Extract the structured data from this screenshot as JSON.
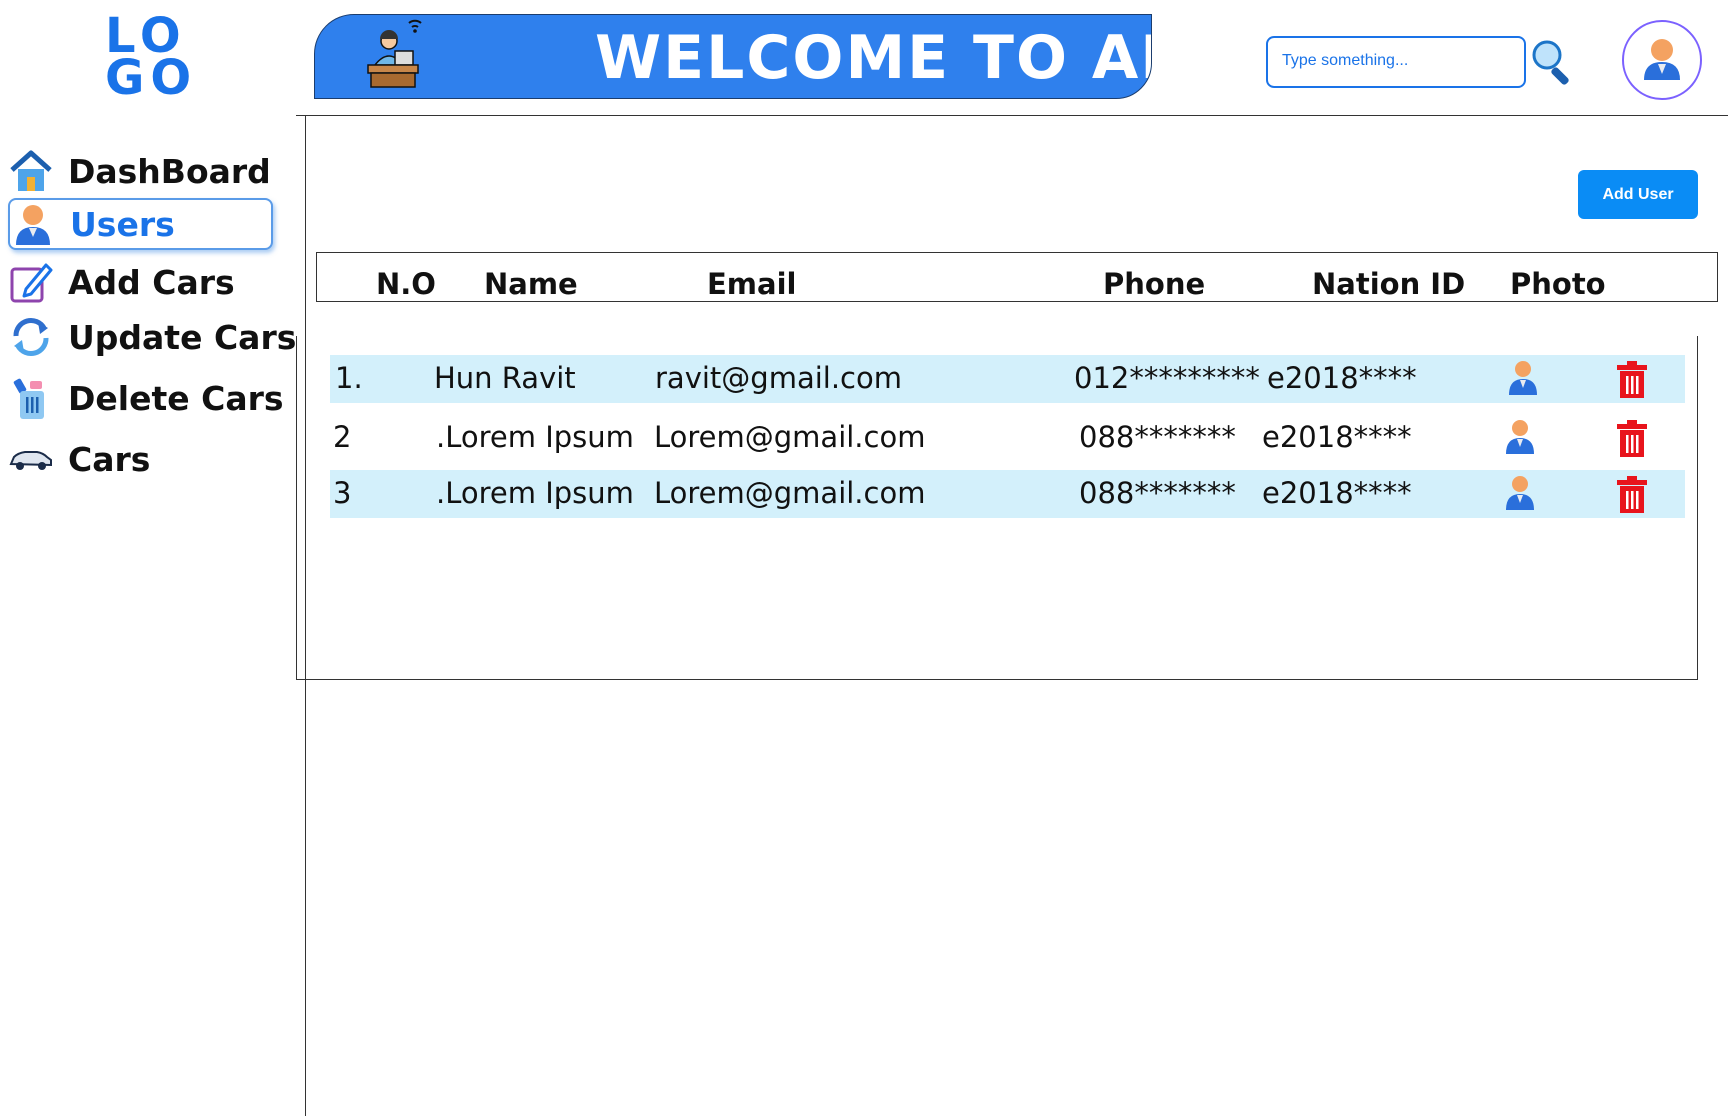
{
  "logo": {
    "line1": "LO",
    "line2": "GO"
  },
  "header": {
    "title": "WELCOME TO ADMIN",
    "search_placeholder": "Type something..."
  },
  "sidebar": {
    "items": [
      {
        "label": "DashBoard",
        "icon": "home-icon",
        "active": false
      },
      {
        "label": "Users",
        "icon": "user-icon",
        "active": true
      },
      {
        "label": "Add Cars",
        "icon": "edit-icon",
        "active": false
      },
      {
        "label": "Update Cars",
        "icon": "refresh-icon",
        "active": false
      },
      {
        "label": "Delete Cars",
        "icon": "trash-icon",
        "active": false
      },
      {
        "label": "Cars",
        "icon": "car-icon",
        "active": false
      }
    ]
  },
  "main": {
    "add_user_label": "Add User",
    "table": {
      "columns": [
        "N.O",
        "Name",
        "Email",
        "Phone",
        "Nation ID",
        "Photo"
      ],
      "rows": [
        {
          "no": "1.",
          "name": "Hun Ravit",
          "email": "ravit@gmail.com",
          "phone": "012*********",
          "nation_id": "e2018****"
        },
        {
          "no": "2",
          "name": ".Lorem Ipsum",
          "email": "Lorem@gmail.com",
          "phone": "088*******",
          "nation_id": "e2018****"
        },
        {
          "no": "3",
          "name": ".Lorem Ipsum",
          "email": "Lorem@gmail.com",
          "phone": "088*******",
          "nation_id": "e2018****"
        }
      ]
    }
  },
  "colors": {
    "accent": "#1a73e8",
    "banner": "#2f80ed",
    "row_highlight": "#d3f0fb",
    "delete": "#e8141c"
  }
}
